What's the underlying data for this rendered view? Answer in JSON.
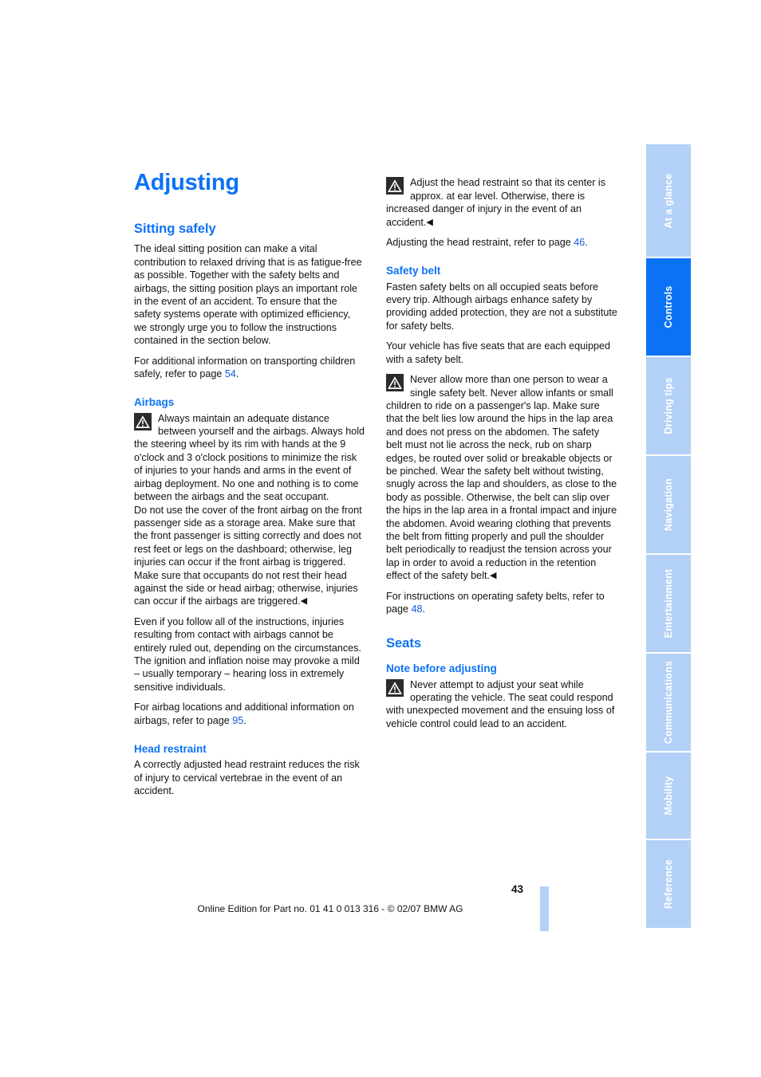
{
  "document": {
    "title": "Adjusting",
    "page_number": "43",
    "footer_note": "Online Edition for Part no. 01 41 0 013 316 - © 02/07 BMW AG"
  },
  "colors": {
    "heading_blue": "#0b72f5",
    "tab_inactive": "#b3d1f7",
    "tab_active": "#0b72f5",
    "link_blue": "#1258e0",
    "warning_icon_bg": "#2b2b2b"
  },
  "tabs": [
    {
      "label": "At a glance",
      "active": false
    },
    {
      "label": "Controls",
      "active": true
    },
    {
      "label": "Driving tips",
      "active": false
    },
    {
      "label": "Navigation",
      "active": false
    },
    {
      "label": "Entertainment",
      "active": false
    },
    {
      "label": "Communications",
      "active": false
    },
    {
      "label": "Mobility",
      "active": false
    },
    {
      "label": "Reference",
      "active": false
    }
  ],
  "left_column": {
    "section_heading": "Sitting safely",
    "intro_paragraph": "The ideal sitting position can make a vital contribution to relaxed driving that is as fatigue-free as possible. Together with the safety belts and airbags, the sitting position plays an important role in the event of an accident. To ensure that the safety systems operate with optimized efficiency, we strongly urge you to follow the instructions contained in the section below.",
    "children_ref_prefix": "For additional information on transporting children safely, refer to page ",
    "children_ref_page": "54",
    "children_ref_suffix": ".",
    "airbags_heading": "Airbags",
    "airbags_warning": "Always maintain an adequate distance between yourself and the airbags. Always hold the steering wheel by its rim with hands at the 9 o'clock and 3 o'clock positions to minimize the risk of injuries to your hands and arms in the event of airbag deployment. No one and nothing is to come between the airbags and the seat occupant.",
    "airbags_warning_cont": "Do not use the cover of the front airbag on the front passenger side as a storage area. Make sure that the front passenger is sitting correctly and does not rest feet or legs on the dashboard; otherwise, leg injuries can occur if the front airbag is triggered. Make sure that occupants do not rest their head against the side or head airbag; otherwise, injuries can occur if the airbags are triggered.",
    "airbags_note": "Even if you follow all of the instructions, injuries resulting from contact with airbags cannot be entirely ruled out, depending on the circumstances. The ignition and inflation noise may provoke a mild – usually temporary – hearing loss in extremely sensitive individuals.",
    "airbags_ref_prefix": "For airbag locations and additional information on airbags, refer to page ",
    "airbags_ref_page": "95",
    "airbags_ref_suffix": ".",
    "head_restraint_heading": "Head restraint",
    "head_restraint_text": "A correctly adjusted head restraint reduces the risk of injury to cervical vertebrae in the event of an accident."
  },
  "right_column": {
    "head_restraint_warning": "Adjust the head restraint so that its center is approx. at ear level. Otherwise, there is increased danger of injury in the event of an accident.",
    "head_restraint_ref_prefix": "Adjusting the head restraint, refer to page ",
    "head_restraint_ref_page": "46",
    "head_restraint_ref_suffix": ".",
    "safety_belt_heading": "Safety belt",
    "safety_belt_p1": "Fasten safety belts on all occupied seats before every trip. Although airbags enhance safety by providing added protection, they are not a substitute for safety belts.",
    "safety_belt_p2": "Your vehicle has five seats that are each equipped with a safety belt.",
    "safety_belt_warning": "Never allow more than one person to wear a single safety belt. Never allow infants or small children to ride on a passenger's lap. Make sure that the belt lies low around the hips in the lap area and does not press on the abdomen. The safety belt must not lie across the neck, rub on sharp edges, be routed over solid or breakable objects or be pinched. Wear the safety belt without twisting, snugly across the lap and shoulders, as close to the body as possible. Otherwise, the belt can slip over the hips in the lap area in a frontal impact and injure the abdomen. Avoid wearing clothing that prevents the belt from fitting properly and pull the shoulder belt periodically to readjust the tension across your lap in order to avoid a reduction in the retention effect of the safety belt.",
    "safety_belt_ref_prefix": "For instructions on operating safety belts, refer to page ",
    "safety_belt_ref_page": "48",
    "safety_belt_ref_suffix": ".",
    "seats_heading": "Seats",
    "note_before_adjusting_heading": "Note before adjusting",
    "note_before_adjusting_warning": "Never attempt to adjust your seat while operating the vehicle. The seat could respond with unexpected movement and the ensuing loss of vehicle control could lead to an accident."
  },
  "symbols": {
    "end_of_warning": "◀"
  }
}
